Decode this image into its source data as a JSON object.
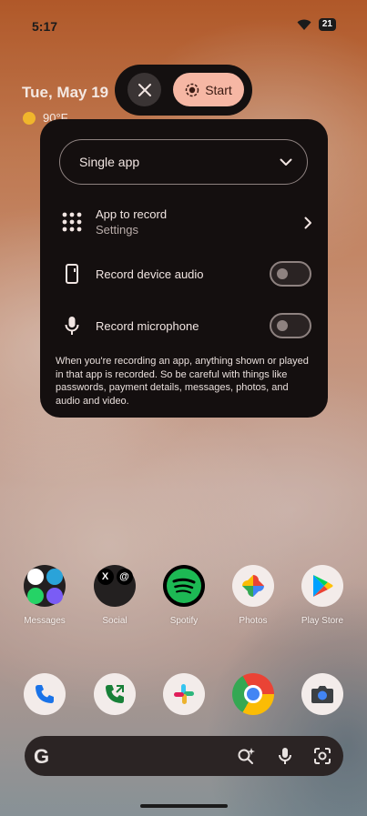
{
  "status_bar": {
    "time": "5:17",
    "battery": "21"
  },
  "widget": {
    "date": "Tue, May 19",
    "temperature": "90°F"
  },
  "recording_controls": {
    "start_label": "Start"
  },
  "dialog": {
    "mode_select": "Single app",
    "app_to_record": {
      "title": "App to record",
      "value": "Settings"
    },
    "device_audio_label": "Record device audio",
    "microphone_label": "Record microphone",
    "note": "When you're recording an app, anything shown or played in that app is recorded. So be careful with things like passwords, payment details, messages, photos, and audio and video."
  },
  "apps_row": [
    {
      "label": "Messages"
    },
    {
      "label": "Social"
    },
    {
      "label": "Spotify"
    },
    {
      "label": "Photos"
    },
    {
      "label": "Play Store"
    }
  ],
  "colors": {
    "accent": "#f6b7a4",
    "dialog_bg": "#140f0f",
    "spotify": "#1db954"
  },
  "icons": [
    "close-icon",
    "record-icon",
    "chevron-down-icon",
    "grid-icon",
    "phone-outline-icon",
    "microphone-icon",
    "chevron-right-icon",
    "google-logo",
    "search-sparkle-icon",
    "lens-icon"
  ]
}
